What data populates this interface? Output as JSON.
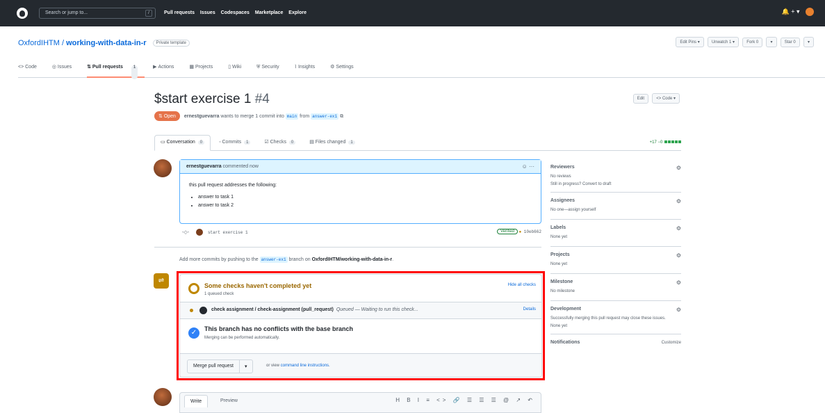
{
  "header": {
    "search_placeholder": "Search or jump to...",
    "slash": "/",
    "nav": [
      "Pull requests",
      "Issues",
      "Codespaces",
      "Marketplace",
      "Explore"
    ],
    "right_icons": "🔔 + ▾"
  },
  "repo": {
    "owner": "OxfordIHTM",
    "separator": " / ",
    "name": "working-with-data-in-r",
    "visibility": "Private template",
    "actions": [
      "Edit Pins ▾",
      "Unwatch 1 ▾",
      "Fork 0",
      "▾",
      "Star 0",
      "▾"
    ]
  },
  "repo_tabs": [
    {
      "label": "<> Code"
    },
    {
      "label": "Issues"
    },
    {
      "label": "Pull requests",
      "count": "1"
    },
    {
      "label": "Actions"
    },
    {
      "label": "Projects"
    },
    {
      "label": "Wiki"
    },
    {
      "label": "Security"
    },
    {
      "label": "Insights"
    },
    {
      "label": "Settings"
    }
  ],
  "pr": {
    "title": "$start exercise 1",
    "number": "#4",
    "edit": "Edit",
    "code": "<> Code ▾",
    "state": "Open",
    "author": "ernestguevarra",
    "summary_mid": " wants to merge 1 commit into ",
    "base": "main",
    "from": " from ",
    "head": "answer-ex1"
  },
  "pr_tabs": [
    {
      "label": "Conversation",
      "count": "0"
    },
    {
      "label": "Commits",
      "count": "1"
    },
    {
      "label": "Checks",
      "count": "0"
    },
    {
      "label": "Files changed",
      "count": "1"
    }
  ],
  "diffstat": "+17 −0",
  "comment": {
    "author": "ernestguevarra",
    "meta": " commented now",
    "icons": "☺ ···",
    "intro": "this pull request addresses the following:",
    "items": [
      "answer to task 1",
      "answer to task 2"
    ]
  },
  "commit": {
    "message": "start exercise 1",
    "verified": "Verified",
    "sha": "10eb662"
  },
  "addmore": {
    "prefix": "Add more commits by pushing to the ",
    "branch": "answer-ex1",
    "mid": " branch on ",
    "repo": "OxfordIHTM/working-with-data-in-r",
    "suffix": "."
  },
  "merge_box": {
    "checks_title": "Some checks haven't completed yet",
    "checks_sub": "1 queued check",
    "hide_checks": "Hide all checks",
    "check_name": "check assignment / check-assignment (pull_request)",
    "check_status": "Queued — Waiting to run this check...",
    "details": "Details",
    "conflict_title": "This branch has no conflicts with the base branch",
    "conflict_sub": "Merging can be performed automatically.",
    "merge_button": "Merge pull request",
    "merge_caret": "▾",
    "or_view": "or view ",
    "cli_link": "command line instructions",
    "cli_suffix": "."
  },
  "editor": {
    "write": "Write",
    "preview": "Preview",
    "tools": "H B I ≡ <> 🔗 ☰ ☰ ☰ @ ↗ ↶"
  },
  "sidebar": [
    {
      "heading": "Reviewers",
      "value": "No reviews",
      "extra": "Still in progress? Convert to draft"
    },
    {
      "heading": "Assignees",
      "value": "No one—assign yourself"
    },
    {
      "heading": "Labels",
      "value": "None yet"
    },
    {
      "heading": "Projects",
      "value": "None yet"
    },
    {
      "heading": "Milestone",
      "value": "No milestone"
    },
    {
      "heading": "Development",
      "value": "Successfully merging this pull request may close these issues.",
      "extra": "None yet"
    },
    {
      "heading": "Notifications",
      "value": "Customize"
    }
  ],
  "colors": {
    "accent": "#0969da",
    "open": "#e5734a",
    "pending": "#bf8700",
    "highlight": "#ff0000"
  }
}
